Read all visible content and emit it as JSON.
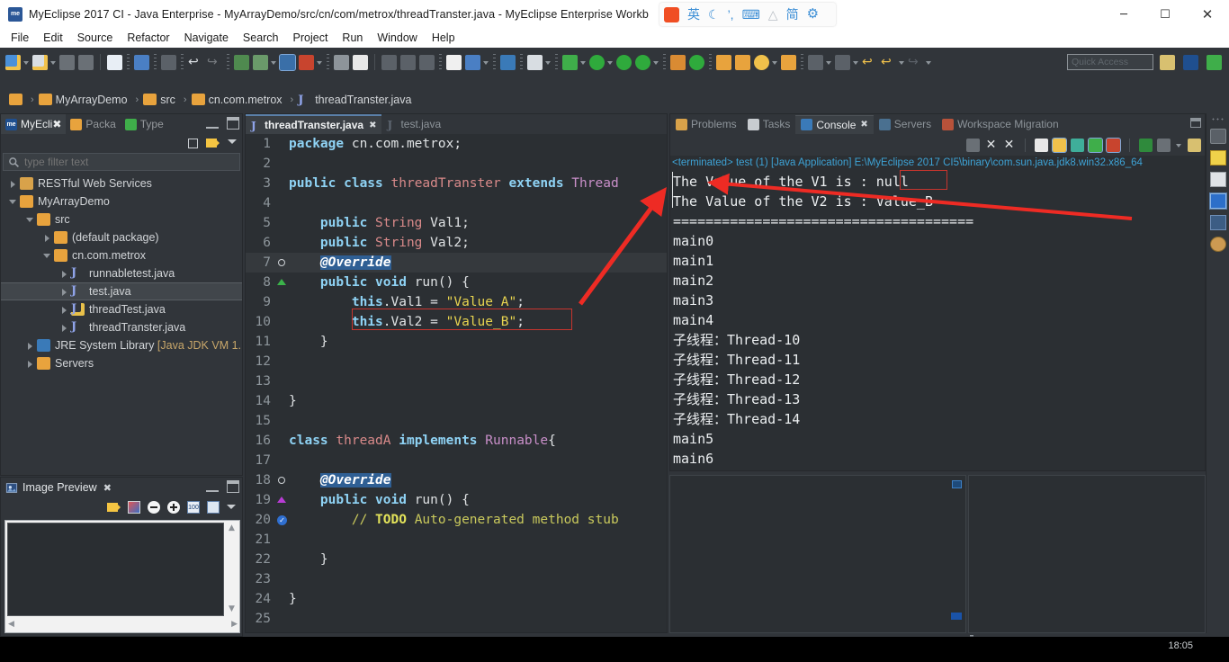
{
  "window": {
    "app_icon": "me",
    "title": "MyEclipse 2017 CI - Java Enterprise - MyArrayDemo/src/cn/com/metrox/threadTranster.java - MyEclipse Enterprise Workb",
    "minimize": "─",
    "maximize": "☐",
    "close": "✕"
  },
  "ime": {
    "logo": "言",
    "items": [
      "英",
      "☾",
      "’,",
      "⌨",
      "△",
      "简",
      "⚙"
    ]
  },
  "menu": {
    "items": [
      "File",
      "Edit",
      "Source",
      "Refactor",
      "Navigate",
      "Search",
      "Project",
      "Run",
      "Window",
      "Help"
    ]
  },
  "quick_access": {
    "placeholder": "Quick Access"
  },
  "breadcrumb": {
    "segments": [
      {
        "icon": "project-folder-icon",
        "label": ""
      },
      {
        "icon": "project-icon",
        "label": "MyArrayDemo"
      },
      {
        "icon": "source-folder-icon",
        "label": "src"
      },
      {
        "icon": "package-icon",
        "label": "cn.com.metrox"
      },
      {
        "icon": "java-file-icon",
        "label": "threadTranster.java"
      }
    ],
    "separator": "›"
  },
  "explorer": {
    "tabs": [
      {
        "label": "MyEcli",
        "icon": "myeclipse-explorer-icon",
        "active": true,
        "closable": true
      },
      {
        "label": "Packa",
        "icon": "package-explorer-icon",
        "active": false,
        "closable": false
      },
      {
        "label": "Type",
        "icon": "type-hierarchy-icon",
        "active": false,
        "closable": false
      }
    ],
    "filter_placeholder": "type filter text",
    "tree": [
      {
        "indent": 0,
        "arrow": "closed",
        "icon": "restful-icon",
        "label": "RESTful Web Services",
        "selected": false
      },
      {
        "indent": 0,
        "arrow": "open",
        "icon": "project-icon",
        "label": "MyArrayDemo",
        "selected": false
      },
      {
        "indent": 1,
        "arrow": "open",
        "icon": "source-folder-icon",
        "label": "src",
        "selected": false
      },
      {
        "indent": 2,
        "arrow": "closed",
        "icon": "package-icon",
        "label": "(default package)",
        "selected": false
      },
      {
        "indent": 2,
        "arrow": "open",
        "icon": "package-icon",
        "label": "cn.com.metrox",
        "selected": false
      },
      {
        "indent": 3,
        "arrow": "closed",
        "icon": "java-file-icon",
        "label": "runnabletest.java",
        "selected": false
      },
      {
        "indent": 3,
        "arrow": "closed",
        "icon": "java-file-icon",
        "label": "test.java",
        "selected": true
      },
      {
        "indent": 3,
        "arrow": "closed",
        "icon": "java-file-warning-icon",
        "label": "threadTest.java",
        "selected": false
      },
      {
        "indent": 3,
        "arrow": "closed",
        "icon": "java-file-icon",
        "label": "threadTranster.java",
        "selected": false
      },
      {
        "indent": 1,
        "arrow": "closed",
        "icon": "jre-library-icon",
        "label": "JRE System Library [Java JDK VM 1.",
        "selected": false
      },
      {
        "indent": 1,
        "arrow": "closed",
        "icon": "folder-icon",
        "label": "Servers",
        "selected": false
      }
    ]
  },
  "image_preview": {
    "title": "Image Preview",
    "toolbar_icons": [
      "sync-icon",
      "palette-icon",
      "zoom-out-icon",
      "zoom-in-icon",
      "zoom-100-icon",
      "fit-image-icon",
      "view-menu-icon"
    ]
  },
  "editor": {
    "tabs": [
      {
        "label": "threadTranster.java",
        "active": true,
        "closable": true
      },
      {
        "label": "test.java",
        "active": false,
        "closable": false
      }
    ],
    "lines": [
      {
        "n": 1,
        "mark": "",
        "tokens": [
          {
            "t": "package ",
            "c": "kw"
          },
          {
            "t": "cn.com.metrox;",
            "c": ""
          }
        ]
      },
      {
        "n": 2,
        "mark": "",
        "tokens": []
      },
      {
        "n": 3,
        "mark": "",
        "tokens": [
          {
            "t": "public class ",
            "c": "kw"
          },
          {
            "t": "threadTranster",
            "c": "typ"
          },
          {
            "t": " ",
            "c": ""
          },
          {
            "t": "extends",
            "c": "kw"
          },
          {
            "t": " ",
            "c": ""
          },
          {
            "t": "Thread",
            "c": "typ2"
          }
        ]
      },
      {
        "n": 4,
        "mark": "",
        "tokens": []
      },
      {
        "n": 5,
        "mark": "",
        "tokens": [
          {
            "t": "    ",
            "c": ""
          },
          {
            "t": "public ",
            "c": "kw"
          },
          {
            "t": "String",
            "c": "typ"
          },
          {
            "t": " Val1;",
            "c": ""
          }
        ]
      },
      {
        "n": 6,
        "mark": "",
        "tokens": [
          {
            "t": "    ",
            "c": ""
          },
          {
            "t": "public ",
            "c": "kw"
          },
          {
            "t": "String",
            "c": "typ"
          },
          {
            "t": " Val2;",
            "c": ""
          }
        ]
      },
      {
        "n": 7,
        "mark": "override",
        "highlight": true,
        "tokens": [
          {
            "t": "    ",
            "c": ""
          },
          {
            "t": "@Override",
            "c": "ann"
          }
        ]
      },
      {
        "n": 8,
        "mark": "arrow-green",
        "tokens": [
          {
            "t": "    ",
            "c": ""
          },
          {
            "t": "public void ",
            "c": "kw"
          },
          {
            "t": "run",
            "c": ""
          },
          {
            "t": "() {",
            "c": ""
          }
        ]
      },
      {
        "n": 9,
        "mark": "",
        "tokens": [
          {
            "t": "        ",
            "c": ""
          },
          {
            "t": "this",
            "c": "thisk"
          },
          {
            "t": ".Val1 = ",
            "c": ""
          },
          {
            "t": "\"Value_A\"",
            "c": "str"
          },
          {
            "t": ";",
            "c": ""
          }
        ]
      },
      {
        "n": 10,
        "mark": "",
        "tokens": [
          {
            "t": "        ",
            "c": ""
          },
          {
            "t": "this",
            "c": "thisk"
          },
          {
            "t": ".Val2 = ",
            "c": ""
          },
          {
            "t": "\"Value_B\"",
            "c": "str"
          },
          {
            "t": ";",
            "c": ""
          }
        ]
      },
      {
        "n": 11,
        "mark": "",
        "tokens": [
          {
            "t": "    }",
            "c": ""
          }
        ]
      },
      {
        "n": 12,
        "mark": "",
        "tokens": []
      },
      {
        "n": 13,
        "mark": "",
        "tokens": []
      },
      {
        "n": 14,
        "mark": "",
        "tokens": [
          {
            "t": "}",
            "c": ""
          }
        ]
      },
      {
        "n": 15,
        "mark": "",
        "tokens": []
      },
      {
        "n": 16,
        "mark": "",
        "tokens": [
          {
            "t": "class ",
            "c": "kw"
          },
          {
            "t": "threadA",
            "c": "typ"
          },
          {
            "t": " ",
            "c": ""
          },
          {
            "t": "implements",
            "c": "kw"
          },
          {
            "t": " ",
            "c": ""
          },
          {
            "t": "Runnable",
            "c": "typ2"
          },
          {
            "t": "{",
            "c": ""
          }
        ]
      },
      {
        "n": 17,
        "mark": "",
        "tokens": []
      },
      {
        "n": 18,
        "mark": "override",
        "tokens": [
          {
            "t": "    ",
            "c": ""
          },
          {
            "t": "@Override",
            "c": "ann"
          }
        ]
      },
      {
        "n": 19,
        "mark": "arrow-purple",
        "tokens": [
          {
            "t": "    ",
            "c": ""
          },
          {
            "t": "public void ",
            "c": "kw"
          },
          {
            "t": "run",
            "c": ""
          },
          {
            "t": "() {",
            "c": ""
          }
        ]
      },
      {
        "n": 20,
        "mark": "check",
        "tokens": [
          {
            "t": "        ",
            "c": ""
          },
          {
            "t": "// ",
            "c": "cmt"
          },
          {
            "t": "TODO",
            "c": "todo"
          },
          {
            "t": " Auto-generated method stub",
            "c": "cmt"
          }
        ]
      },
      {
        "n": 21,
        "mark": "",
        "tokens": []
      },
      {
        "n": 22,
        "mark": "",
        "tokens": [
          {
            "t": "    }",
            "c": ""
          }
        ]
      },
      {
        "n": 23,
        "mark": "",
        "tokens": []
      },
      {
        "n": 24,
        "mark": "",
        "tokens": [
          {
            "t": "}",
            "c": ""
          }
        ]
      },
      {
        "n": 25,
        "mark": "",
        "tokens": []
      }
    ]
  },
  "console": {
    "tabs": [
      {
        "label": "Problems",
        "icon": "problems-icon",
        "active": false,
        "closable": false
      },
      {
        "label": "Tasks",
        "icon": "tasks-icon",
        "active": false,
        "closable": false
      },
      {
        "label": "Console",
        "icon": "console-icon",
        "active": true,
        "closable": true
      },
      {
        "label": "Servers",
        "icon": "servers-icon",
        "active": false,
        "closable": false
      },
      {
        "label": "Workspace Migration",
        "icon": "migration-icon",
        "active": false,
        "closable": false
      }
    ],
    "toolbar_icons": [
      "terminate-icon",
      "remove-launch-icon",
      "remove-all-launches-icon",
      "clear-console-icon",
      "scroll-lock-icon",
      "word-wrap-icon",
      "pin-console-icon",
      "display-selected-console-icon",
      "open-console-icon",
      "new-console-view-icon"
    ],
    "status_line": "<terminated> test (1) [Java Application] E:\\MyEclipse 2017 CI5\\binary\\com.sun.java.jdk8.win32.x86_64",
    "output": [
      "The Value of the V1 is : null",
      "The Value of the V2 is : Value_B",
      "=====================================",
      "main0",
      "main1",
      "main2",
      "main3",
      "main4",
      "子线程：Thread-10",
      "子线程：Thread-11",
      "子线程：Thread-12",
      "子线程：Thread-13",
      "子线程：Thread-14",
      "main5",
      "main6"
    ]
  },
  "fastview": {
    "items": [
      "fast-view-icon",
      "outline-icon",
      "tasks-view-icon",
      "console-view-icon",
      "servers-view-icon",
      "snippets-icon"
    ]
  },
  "annotations": {
    "arrow_color": "#ee2b24",
    "highlight_box_color": "#c7352e",
    "null_box_label": "null",
    "value_a_box_label": "this.Val1 = \"Value_A\";"
  },
  "statusbar": {
    "time": "18:05"
  }
}
